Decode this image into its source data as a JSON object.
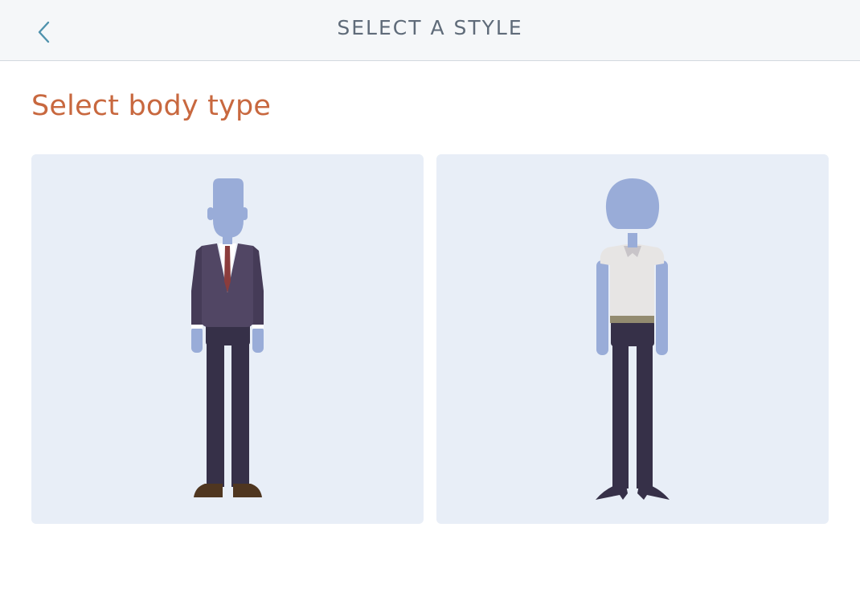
{
  "header": {
    "title": "SELECT A STYLE",
    "back_icon": "chevron-left-icon"
  },
  "main": {
    "section_title": "Select body type",
    "options": [
      {
        "figure": "suit-figure",
        "icon": "body-type-suit-icon"
      },
      {
        "figure": "casual-figure",
        "icon": "body-type-casual-icon"
      }
    ]
  },
  "colors": {
    "header_bg": "#f5f7f9",
    "title_text": "#5f6b79",
    "accent": "#c8683f",
    "back_icon": "#4f92ad",
    "card_bg": "#e8eef7",
    "skin": "#99acd8",
    "trousers": "#363048",
    "jacket": "#514664",
    "tie": "#8b3c3c",
    "shoes": "#4f3620",
    "tshirt": "#e7e5e4",
    "belt": "#938b70"
  }
}
